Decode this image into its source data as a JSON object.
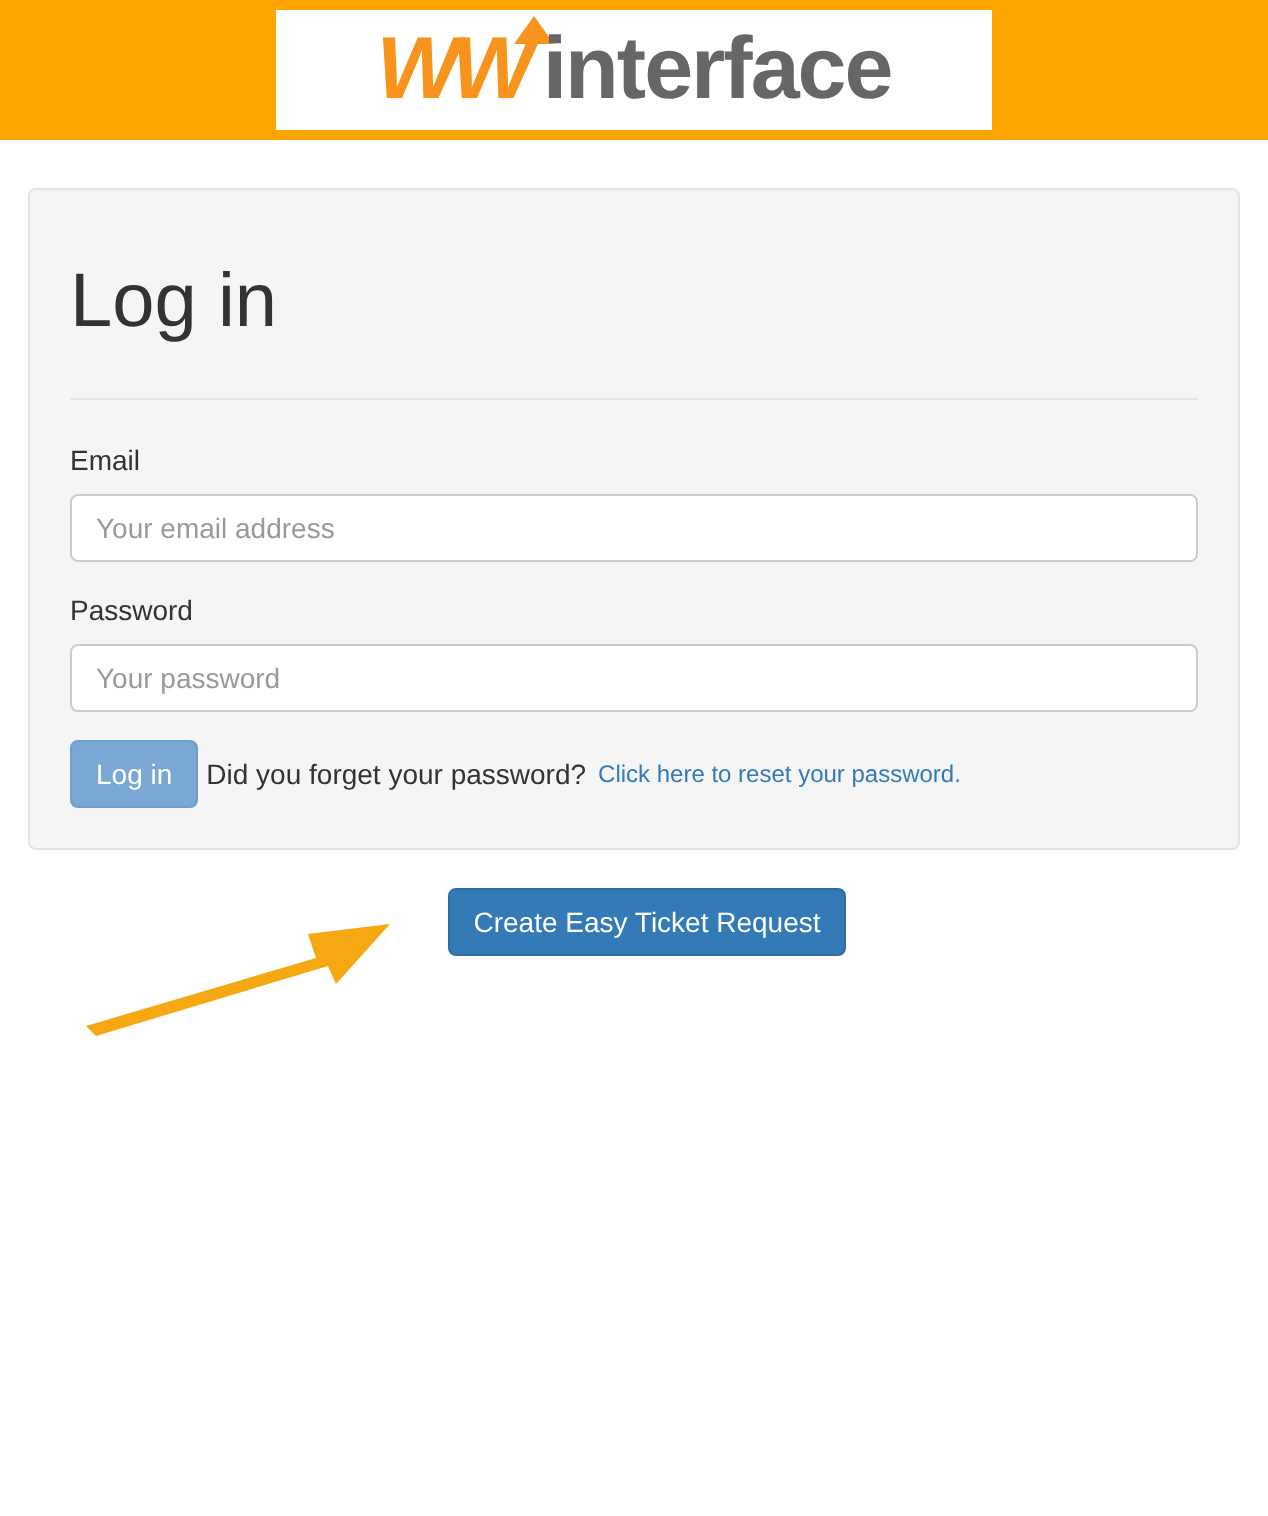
{
  "logo": {
    "accent": "WW",
    "text": "interface"
  },
  "form": {
    "title": "Log in",
    "fields": [
      {
        "label": "Email",
        "placeholder": "Your email address"
      },
      {
        "label": "Password",
        "placeholder": "Your password"
      }
    ],
    "submit": {
      "label": "Log in",
      "disabled": true
    },
    "forgot_text": "Did you forget your password?",
    "reset_link": "Click here to reset your password."
  },
  "ticket_button": "Create Easy Ticket Request"
}
